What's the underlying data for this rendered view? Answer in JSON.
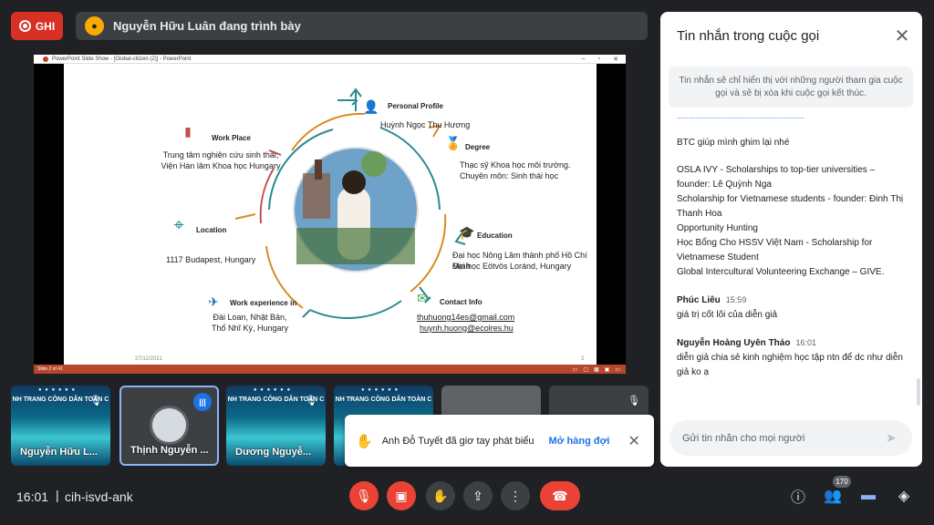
{
  "recording": {
    "label": "GHI"
  },
  "presenter": {
    "text": "Nguyễn Hữu Luân đang trình bày"
  },
  "ppt": {
    "window_title": "PowerPoint Slide Show - [Global-citizen (2)] - PowerPoint",
    "status_left": "Slide 2 of 41",
    "slide": {
      "personal_profile_label": "Personal Profile",
      "personal_profile_value": "Huỳnh Ngọc Thu Hương",
      "work_place_label": "Work Place",
      "work_place_line1": "Trung tâm nghiên cứu sinh thái,",
      "work_place_line2": "Viện Hàn lâm Khoa học Hungary",
      "degree_label": "Degree",
      "degree_line1": "Thạc sỹ Khoa học môi trường.",
      "degree_line2": "Chuyên môn: Sinh thái học",
      "location_label": "Location",
      "location_value": "1117 Budapest, Hungary",
      "education_label": "Education",
      "education_line1": "Đại học Nông Lâm thành phố Hồ Chí Minh",
      "education_line2": "Đại học Eötvös Loránd, Hungary",
      "work_exp_label": "Work experience in",
      "work_exp_line1": "Đài Loan, Nhật Bản,",
      "work_exp_line2": "Thổ Nhĩ Kỳ, Hungary",
      "contact_label": "Contact Info",
      "email1": "thuhuong14es@gmail.com",
      "email2": "huynh.huong@ecolres.hu",
      "date": "27/12/2021",
      "page_number": "2"
    }
  },
  "chat": {
    "title": "Tin nhắn trong cuộc gọi",
    "note": "Tin nhắn sẽ chỉ hiển thị với những người tham gia cuộc gọi và sẽ bị xóa khi cuộc gọi kết thúc.",
    "msg1": "BTC giúp mình ghim lại nhé",
    "msg2_lines": [
      "OSLA IVY - Scholarships to top-tier universities – founder: Lê Quỳnh Nga",
      "Scholarship for Vietnamese students - founder: Đinh Thị Thanh Hoa",
      "Opportunity Hunting",
      "Học Bổng Cho HSSV Việt Nam - Scholarship for Vietnamese Student",
      "Global Intercultural Volunteering Exchange – GIVE."
    ],
    "sender1": {
      "name": "Phúc Liêu",
      "time": "15:59",
      "text": "giá trị cốt lõi của diễn giả"
    },
    "sender2": {
      "name": "Nguyễn Hoàng Uyên Thảo",
      "time": "16:01",
      "text": "diễn giả chia sẻ kinh nghiệm học tập ntn để dc như diễn giả ko ạ"
    },
    "input_placeholder": "Gửi tin nhắn cho mọi người"
  },
  "tiles": {
    "banner": "NH TRANG CÔNG DÂN TOÀN C",
    "t1_name": "Nguyễn Hữu L...",
    "t2_name": "Thịnh Nguyễn ...",
    "t3_name": "Dương Nguyễ..."
  },
  "toast": {
    "text": "Anh Đỗ Tuyết đã giơ tay phát biểu",
    "action": "Mở hàng đợi"
  },
  "bottom": {
    "time": "16:01",
    "separator": "|",
    "meeting_code": "cih-isvd-ank",
    "participants_count": "170"
  },
  "colors": {
    "accent": "#1a73e8",
    "danger": "#ea4335",
    "background": "#202124",
    "ppt_status": "#b7472a"
  }
}
